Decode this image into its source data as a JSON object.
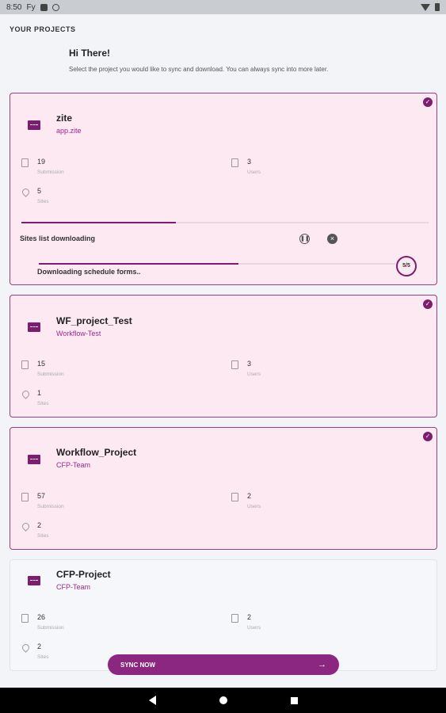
{
  "status_bar": {
    "time": "8:50",
    "indicators": [
      "Fy",
      "sim-icon",
      "data-saver-icon"
    ],
    "right_icons": [
      "wifi-icon",
      "battery-icon"
    ]
  },
  "header": {
    "section_title": "YOUR PROJECTS",
    "greeting": "Hi There!",
    "subtitle": "Select the project you would like to sync and download. You can always sync into more later."
  },
  "stat_labels": {
    "submission": "Submission",
    "users": "Users",
    "sites": "Sites"
  },
  "projects": [
    {
      "name": "zite",
      "org": "app.zite",
      "submissions": "19",
      "users": "3",
      "sites": "5",
      "selected": true
    },
    {
      "name": "WF_project_Test",
      "org": "Workflow-Test",
      "submissions": "15",
      "users": "3",
      "sites": "1",
      "selected": true
    },
    {
      "name": "Workflow_Project",
      "org": "CFP-Team",
      "submissions": "57",
      "users": "2",
      "sites": "2",
      "selected": true
    },
    {
      "name": "CFP-Project",
      "org": "CFP-Team",
      "submissions": "26",
      "users": "2",
      "sites": "2",
      "selected": false
    }
  ],
  "download": {
    "sites_status": "Sites list downloading",
    "sites_progress": 0.38,
    "forms_status": "Downloading schedule forms..",
    "forms_progress": 0.56,
    "counter": "5/5"
  },
  "actions": {
    "sync_now": "SYNC NOW"
  },
  "colors": {
    "accent": "#7c1d6f",
    "card_selected_bg": "#fde9f1",
    "card_border": "#9c3e83",
    "button": "#8b2781"
  }
}
